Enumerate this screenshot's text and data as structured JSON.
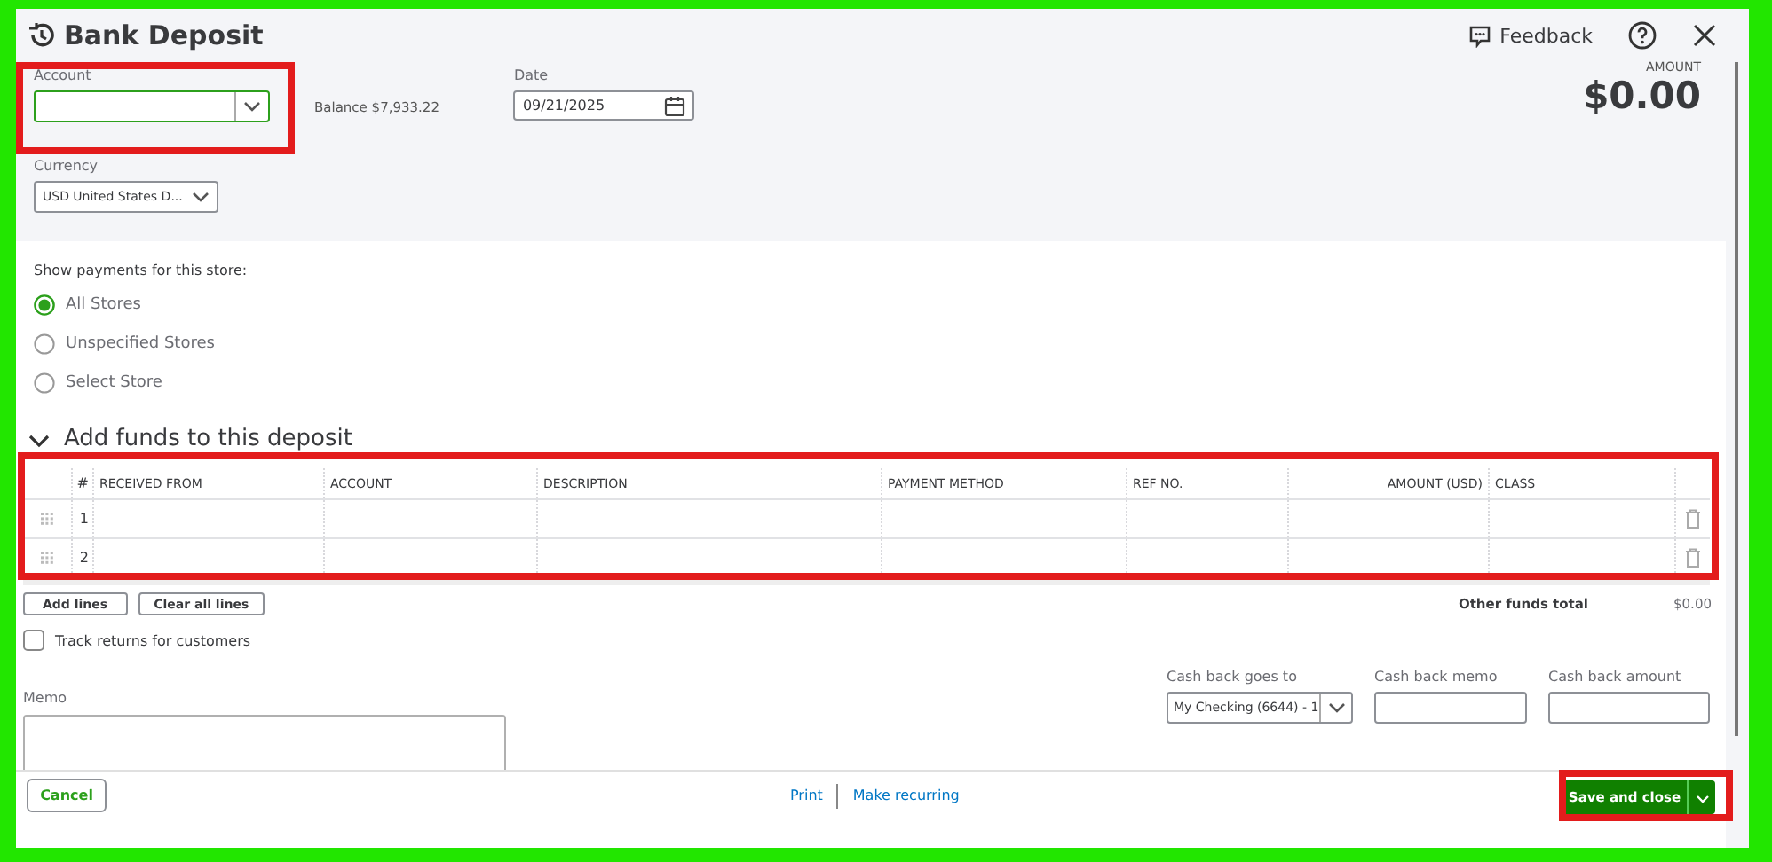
{
  "window": {
    "title": "Bank Deposit",
    "feedback": "Feedback"
  },
  "account": {
    "label": "Account",
    "balance": "Balance $7,933.22"
  },
  "date": {
    "label": "Date",
    "value": "09/21/2025"
  },
  "amount": {
    "label": "AMOUNT",
    "value": "$0.00"
  },
  "currency": {
    "label": "Currency",
    "value": "USD United States D..."
  },
  "store_filter": {
    "label": "Show payments for this store:",
    "options": [
      {
        "label": "All Stores",
        "selected": true
      },
      {
        "label": "Unspecified Stores",
        "selected": false
      },
      {
        "label": "Select Store",
        "selected": false
      }
    ]
  },
  "funds_section": {
    "title": "Add funds to this deposit",
    "expanded": true
  },
  "table": {
    "columns": [
      "#",
      "RECEIVED FROM",
      "ACCOUNT",
      "DESCRIPTION",
      "PAYMENT METHOD",
      "REF NO.",
      "AMOUNT (USD)",
      "CLASS"
    ],
    "rows": [
      {
        "number": "1"
      },
      {
        "number": "2"
      }
    ]
  },
  "table_buttons": [
    "Add lines",
    "Clear all lines"
  ],
  "other_funds_total": {
    "label": "Other funds total",
    "value": "$0.00"
  },
  "track_returns": {
    "label": "Track returns for customers",
    "checked": false
  },
  "memo": {
    "label": "Memo"
  },
  "cash_back": {
    "goes_to": {
      "label": "Cash back goes to",
      "value": "My Checking (6644) - 1"
    },
    "memo": {
      "label": "Cash back memo"
    },
    "amount": {
      "label": "Cash back amount"
    }
  },
  "footer": {
    "cancel": "Cancel",
    "links": [
      "Print",
      "Make recurring"
    ],
    "save": "Save and close"
  }
}
